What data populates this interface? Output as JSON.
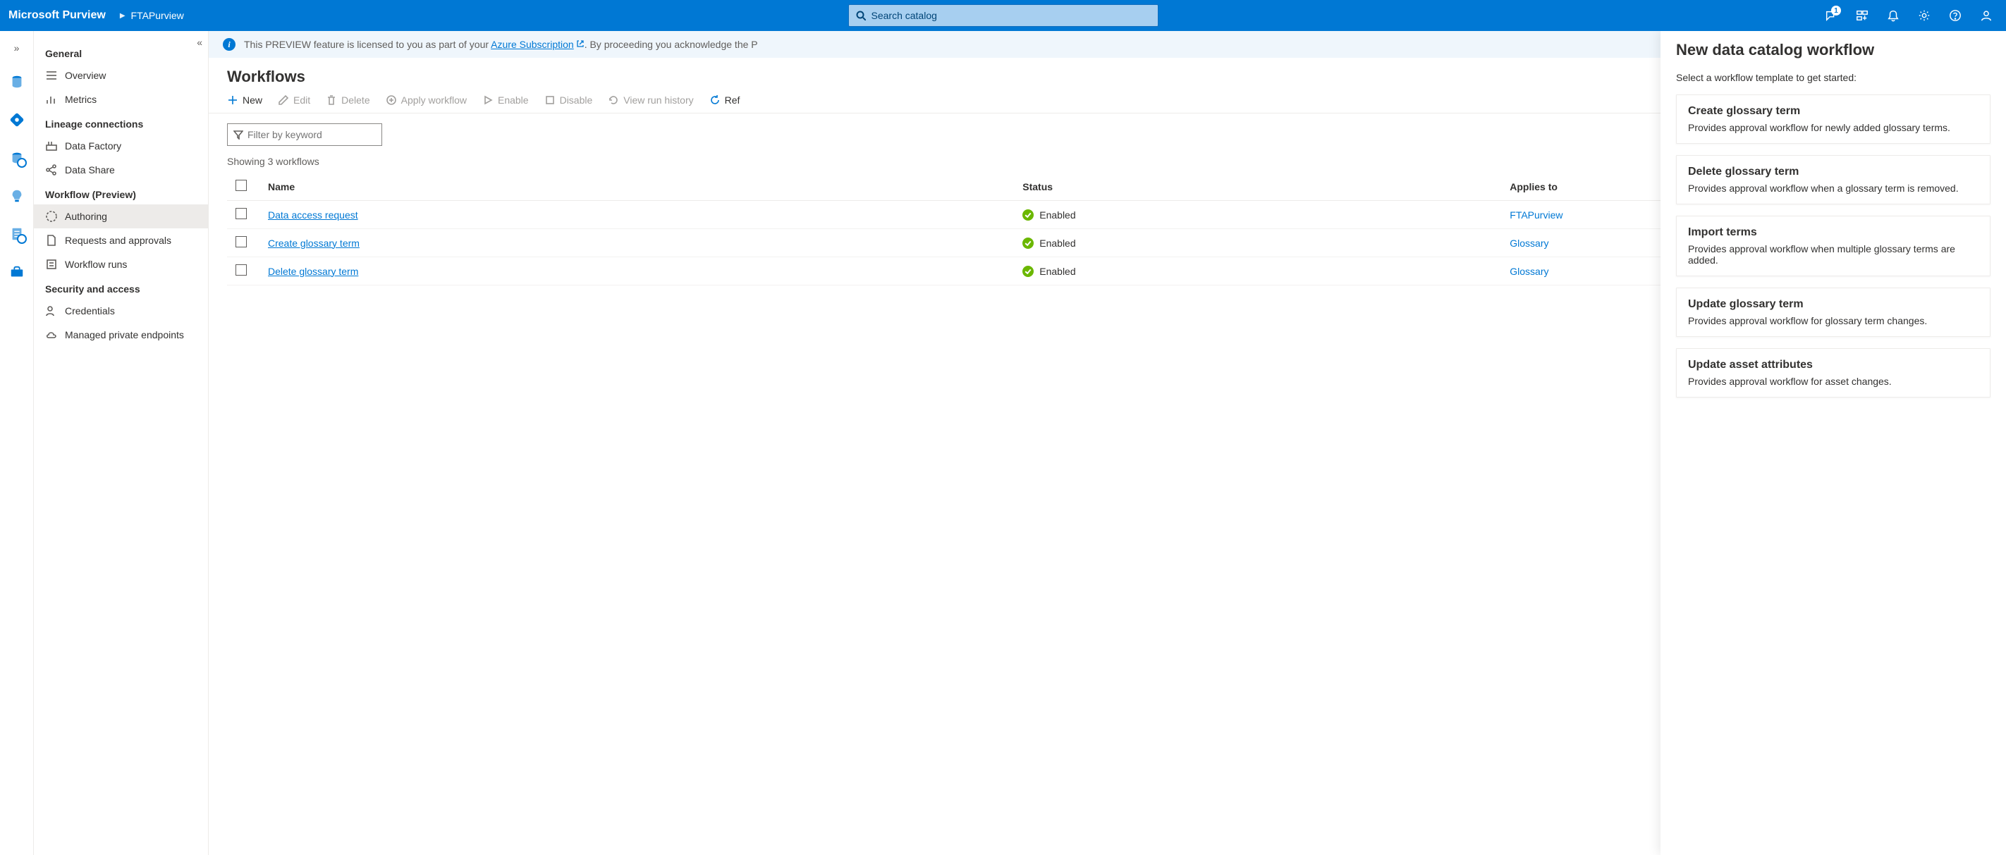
{
  "header": {
    "brand": "Microsoft Purview",
    "account": "FTAPurview",
    "search_placeholder": "Search catalog",
    "feedback_badge": "1"
  },
  "banner": {
    "pre_text": "This PREVIEW feature is licensed to you as part of your ",
    "link_text": "Azure Subscription",
    "post_text": ". By proceeding you acknowledge the P"
  },
  "sidenav": {
    "sections": [
      {
        "title": "General",
        "items": [
          {
            "label": "Overview"
          },
          {
            "label": "Metrics"
          }
        ]
      },
      {
        "title": "Lineage connections",
        "items": [
          {
            "label": "Data Factory"
          },
          {
            "label": "Data Share"
          }
        ]
      },
      {
        "title": "Workflow (Preview)",
        "items": [
          {
            "label": "Authoring",
            "active": true
          },
          {
            "label": "Requests and approvals"
          },
          {
            "label": "Workflow runs"
          }
        ]
      },
      {
        "title": "Security and access",
        "items": [
          {
            "label": "Credentials"
          },
          {
            "label": "Managed private endpoints"
          }
        ]
      }
    ]
  },
  "page": {
    "title": "Workflows",
    "commands": {
      "new": "New",
      "edit": "Edit",
      "delete": "Delete",
      "apply": "Apply workflow",
      "enable": "Enable",
      "disable": "Disable",
      "history": "View run history",
      "refresh": "Ref"
    },
    "filter_placeholder": "Filter by keyword",
    "showing_text": "Showing 3 workflows",
    "columns": {
      "name": "Name",
      "status": "Status",
      "applies": "Applies to"
    },
    "rows": [
      {
        "name": "Data access request",
        "status": "Enabled",
        "applies_to": "FTAPurview"
      },
      {
        "name": "Create glossary term",
        "status": "Enabled",
        "applies_to": "Glossary"
      },
      {
        "name": "Delete glossary term",
        "status": "Enabled",
        "applies_to": "Glossary"
      }
    ]
  },
  "flyout": {
    "title": "New data catalog workflow",
    "subtitle": "Select a workflow template to get started:",
    "templates": [
      {
        "title": "Create glossary term",
        "desc": "Provides approval workflow for newly added glossary terms."
      },
      {
        "title": "Delete glossary term",
        "desc": "Provides approval workflow when a glossary term is removed."
      },
      {
        "title": "Import terms",
        "desc": "Provides approval workflow when multiple glossary terms are added."
      },
      {
        "title": "Update glossary term",
        "desc": "Provides approval workflow for glossary term changes."
      },
      {
        "title": "Update asset attributes",
        "desc": "Provides approval workflow for asset changes."
      }
    ]
  }
}
